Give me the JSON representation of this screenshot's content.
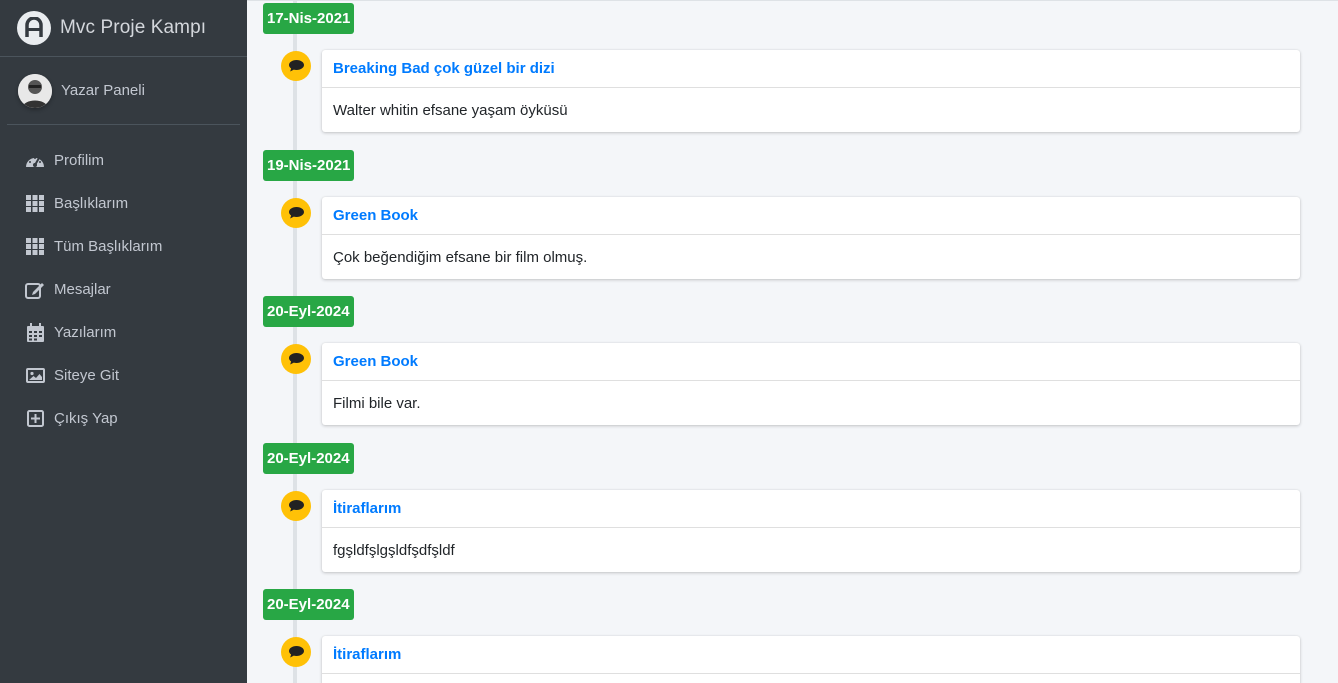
{
  "brand": {
    "title": "Mvc Proje Kampı"
  },
  "user": {
    "name": "Yazar Paneli"
  },
  "nav": [
    {
      "label": "Profilim",
      "icon": "tachometer-icon"
    },
    {
      "label": "Başlıklarım",
      "icon": "grid-icon"
    },
    {
      "label": "Tüm Başlıklarım",
      "icon": "grid-icon"
    },
    {
      "label": "Mesajlar",
      "icon": "edit-icon"
    },
    {
      "label": "Yazılarım",
      "icon": "calendar-icon"
    },
    {
      "label": "Siteye Git",
      "icon": "image-icon"
    },
    {
      "label": "Çıkış Yap",
      "icon": "plus-square-icon"
    }
  ],
  "timeline": [
    {
      "date": "17-Nis-2021",
      "title": "Breaking Bad çok güzel bir dizi",
      "body": "Walter whitin efsane yaşam öyküsü"
    },
    {
      "date": "19-Nis-2021",
      "title": "Green Book",
      "body": "Çok beğendiğim efsane bir film olmuş."
    },
    {
      "date": "20-Eyl-2024",
      "title": "Green Book",
      "body": "Filmi bile var."
    },
    {
      "date": "20-Eyl-2024",
      "title": "İtiraflarım",
      "body": "fgşldfşlgşldfşdfşldf"
    },
    {
      "date": "20-Eyl-2024",
      "title": "İtiraflarım",
      "body": ""
    }
  ],
  "colors": {
    "sidebar": "#343a40",
    "date_badge": "#28a745",
    "bubble": "#ffc107",
    "link": "#007bff"
  }
}
